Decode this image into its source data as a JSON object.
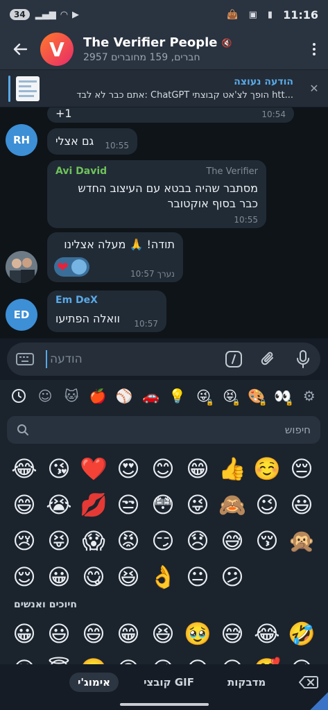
{
  "status_bar": {
    "badge": "34",
    "time": "11:16"
  },
  "header": {
    "title": "The Verifier People",
    "subtitle": "2957 חברים, 159 מחוברים",
    "logo_letter": "V"
  },
  "pinned": {
    "title": "הודעה נעוצה",
    "body": "אתם כבר לא לבד: ChatGPT הופך לצ'אט קבוצתי  htt..."
  },
  "messages": [
    {
      "text": "+1",
      "time": "10:54"
    },
    {
      "avatar": "RH",
      "avatar_color": "#3d8fd6",
      "text": "גם אצלי",
      "time": "10:55"
    },
    {
      "sender": "Avi David",
      "sender_color": "#6fc25a",
      "admin": "The Verifier",
      "text": "מסתבר שהיה בבטא עם העיצוב החדש כבר בסוף אוקטובר",
      "time": "10:55"
    },
    {
      "text": "תודה! 🙏 מעלה אצלינו",
      "time": "10:57",
      "edited": "נערך"
    },
    {
      "avatar": "ED",
      "avatar_color": "#3d8fd6",
      "sender": "Em DeX",
      "sender_color": "#5aa9e6",
      "text": "וואלה הפתיעו",
      "time": "10:57"
    }
  ],
  "input": {
    "placeholder": "הודעה"
  },
  "emoji_panel": {
    "categories": [
      "recent-icon",
      "smileys-icon",
      "animals-icon",
      "food-icon",
      "sports-icon",
      "travel-icon",
      "objects-icon",
      "pack-1",
      "pack-2",
      "pack-3",
      "pack-4",
      "settings-icon"
    ],
    "search_placeholder": "חיפוש",
    "recent": [
      "😂",
      "😘",
      "❤️",
      "😍",
      "😊",
      "😁",
      "👍",
      "☺️",
      "😔",
      "😄",
      "😭",
      "💋",
      "😒",
      "😳",
      "😜",
      "🙈",
      "😉",
      "😃",
      "😢",
      "😝",
      "😱",
      "😡",
      "😏",
      "😞",
      "😅",
      "😚",
      "🙊",
      "😌",
      "😀",
      "😋",
      "😆",
      "👌",
      "😐",
      "😕"
    ],
    "section_title": "חיוכים ואנשים",
    "people": [
      "😀",
      "😃",
      "😄",
      "😁",
      "😆",
      "🥹",
      "😅",
      "😂",
      "🤣",
      "😊",
      "😇",
      "🙂",
      "🙃",
      "😉",
      "😌",
      "😍",
      "🥰",
      "😘"
    ]
  },
  "bottom_tabs": {
    "stickers": "מדבקות",
    "gifs": "קובצי GIF",
    "emoji": "אימוג'י"
  }
}
